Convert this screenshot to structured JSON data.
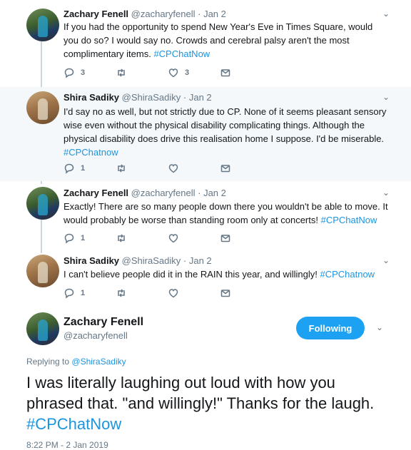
{
  "replies": [
    {
      "name": "Zachary Fenell",
      "handle": "@zacharyfenell",
      "date": "Jan 2",
      "text": "If you had the opportunity to spend New Year's Eve in Times Square, would you do so? I would say no. Crowds and cerebral palsy aren't the most complimentary items.",
      "hashtag": "#CPChatNow",
      "replies_count": "3",
      "retweets_count": "",
      "likes_count": "3"
    },
    {
      "name": "Shira Sadiky",
      "handle": "@ShiraSadiky",
      "date": "Jan 2",
      "text": "I'd say no as well, but not strictly due to CP. None of it seems pleasant sensory wise even without the physical disability complicating things. Although the physical disability does drive this realisation home I suppose. I'd be miserable.",
      "hashtag": "#CPChatnow",
      "replies_count": "1",
      "retweets_count": "",
      "likes_count": ""
    },
    {
      "name": "Zachary Fenell",
      "handle": "@zacharyfenell",
      "date": "Jan 2",
      "text": "Exactly! There are so many people down there you wouldn't be able to move. It would probably be worse than standing room only at concerts!",
      "hashtag": "#CPChatNow",
      "replies_count": "1",
      "retweets_count": "",
      "likes_count": ""
    },
    {
      "name": "Shira Sadiky",
      "handle": "@ShiraSadiky",
      "date": "Jan 2",
      "text": "I can't believe people did it in the RAIN this year, and willingly!",
      "hashtag": "#CPChatnow",
      "replies_count": "1",
      "retweets_count": "",
      "likes_count": ""
    }
  ],
  "main_tweet": {
    "name": "Zachary Fenell",
    "handle": "@zacharyfenell",
    "follow_label": "Following",
    "replying_prefix": "Replying to",
    "replying_to": "@ShiraSadiky",
    "text": "I was literally laughing out loud with how you phrased that. \"and willingly!\" Thanks for the laugh.",
    "hashtag": "#CPChatNow",
    "timestamp": "8:22 PM - 2 Jan 2019"
  },
  "icons": {
    "reply": "reply-icon",
    "retweet": "retweet-icon",
    "like": "like-icon",
    "message": "message-icon",
    "caret": "chevron-down-icon"
  },
  "colors": {
    "accent": "#1da1f2",
    "link": "#1b95e0",
    "highlight_bg": "#f5f8fa"
  }
}
